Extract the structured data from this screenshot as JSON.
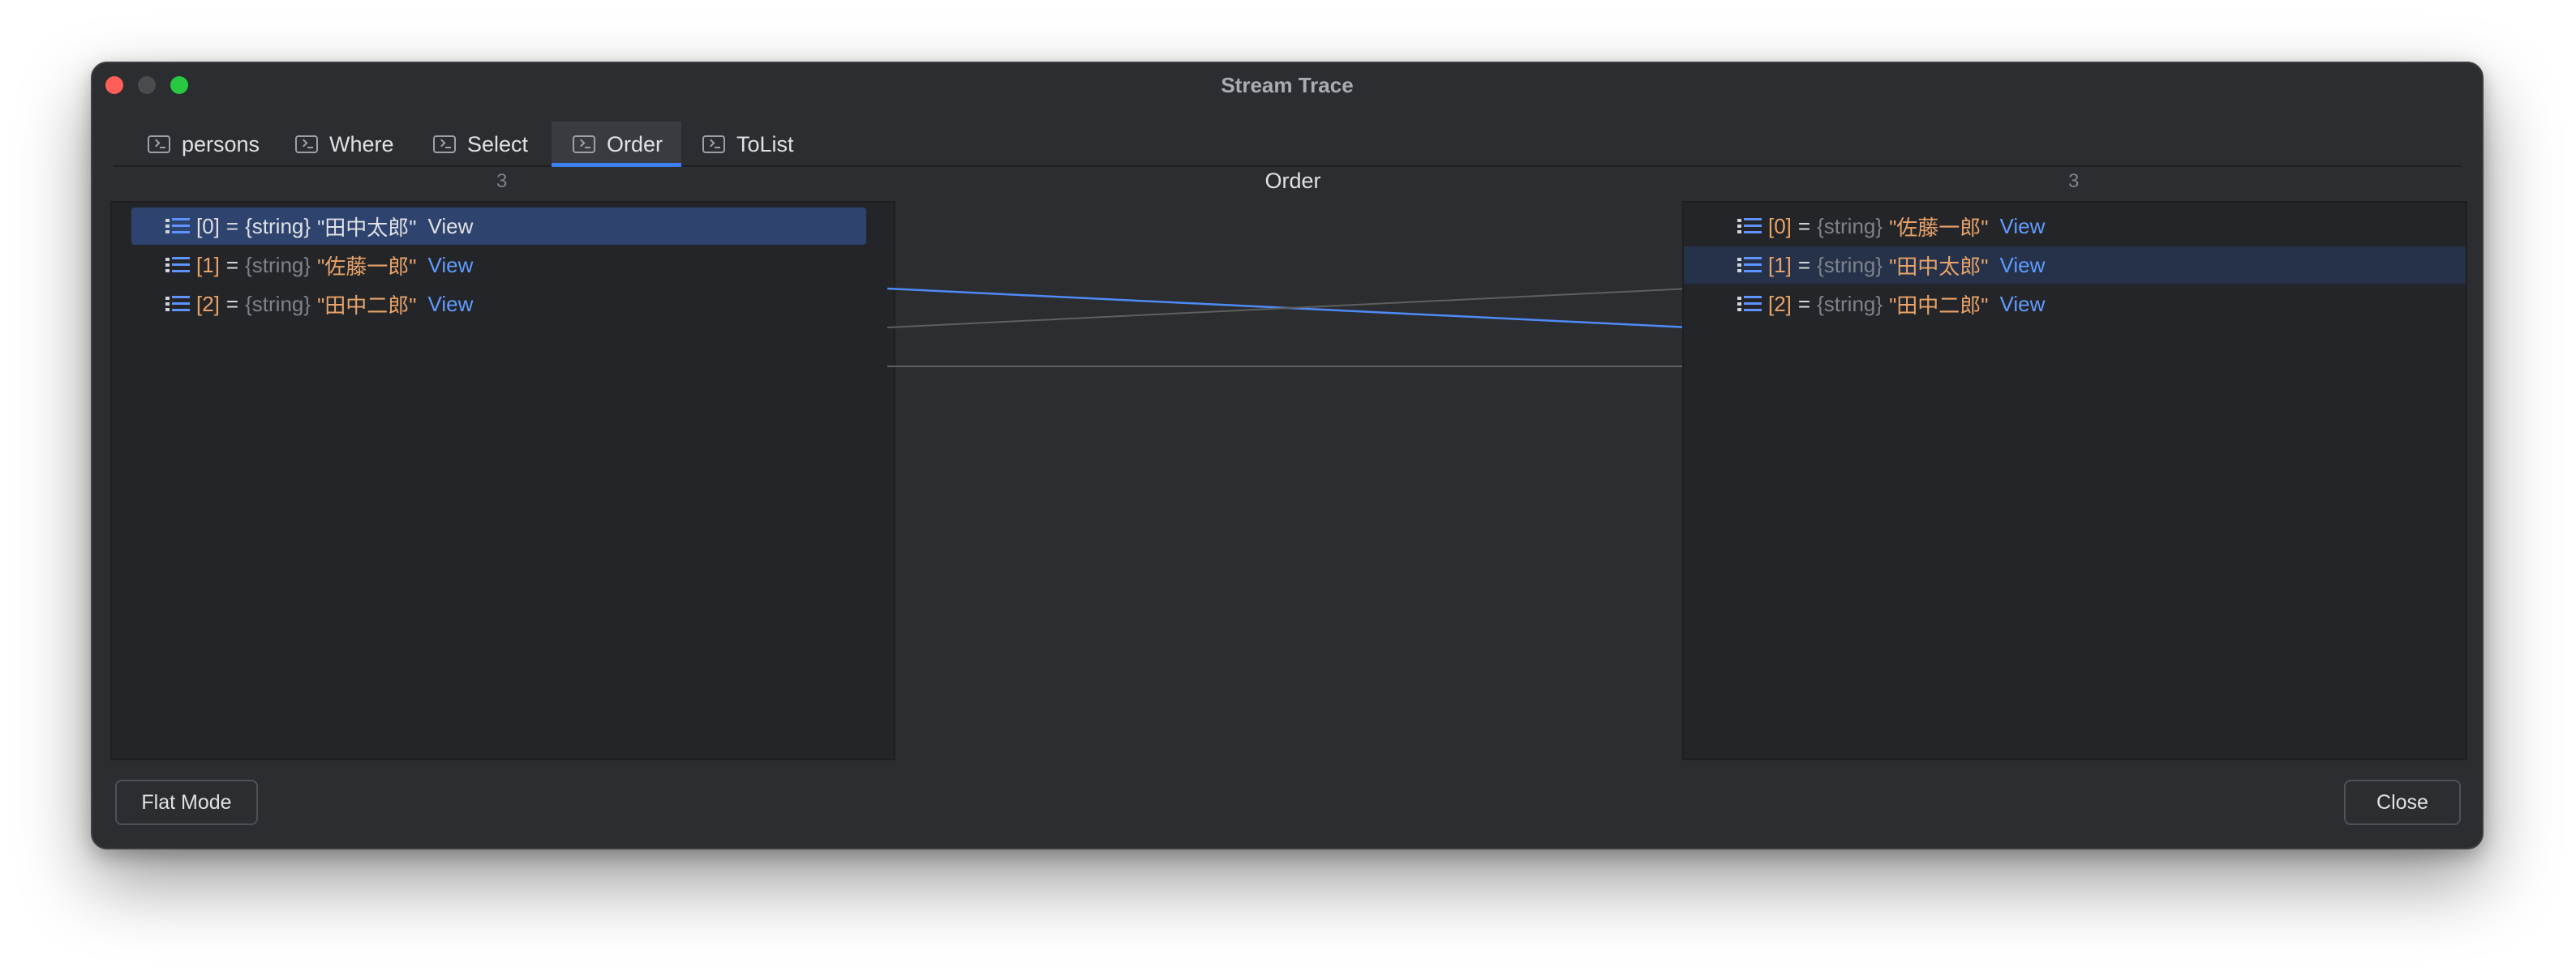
{
  "window": {
    "title": "Stream Trace"
  },
  "tabs": [
    {
      "label": "persons",
      "icon": "console-icon"
    },
    {
      "label": "Where",
      "icon": "console-icon"
    },
    {
      "label": "Select",
      "icon": "console-icon"
    },
    {
      "label": "Order",
      "icon": "console-icon",
      "active": true
    },
    {
      "label": "ToList",
      "icon": "console-icon"
    }
  ],
  "left_column": {
    "count": "3",
    "items": [
      {
        "index": "[0]",
        "eq": "=",
        "type": "{string}",
        "value": "\"田中太郎\"",
        "link": "View"
      },
      {
        "index": "[1]",
        "eq": "=",
        "type": "{string}",
        "value": "\"佐藤一郎\"",
        "link": "View"
      },
      {
        "index": "[2]",
        "eq": "=",
        "type": "{string}",
        "value": "\"田中二郎\"",
        "link": "View"
      }
    ]
  },
  "center": {
    "title": "Order"
  },
  "right_column": {
    "count": "3",
    "items": [
      {
        "index": "[0]",
        "eq": "=",
        "type": "{string}",
        "value": "\"佐藤一郎\"",
        "link": "View"
      },
      {
        "index": "[1]",
        "eq": "=",
        "type": "{string}",
        "value": "\"田中太郎\"",
        "link": "View"
      },
      {
        "index": "[2]",
        "eq": "=",
        "type": "{string}",
        "value": "\"田中二郎\"",
        "link": "View"
      }
    ]
  },
  "buttons": {
    "flat_mode": "Flat Mode",
    "close": "Close"
  },
  "colors": {
    "accent": "#3d7ef0",
    "link": "#5f9bff",
    "index": "#e8a36a",
    "connector": "#5f5f5f"
  }
}
